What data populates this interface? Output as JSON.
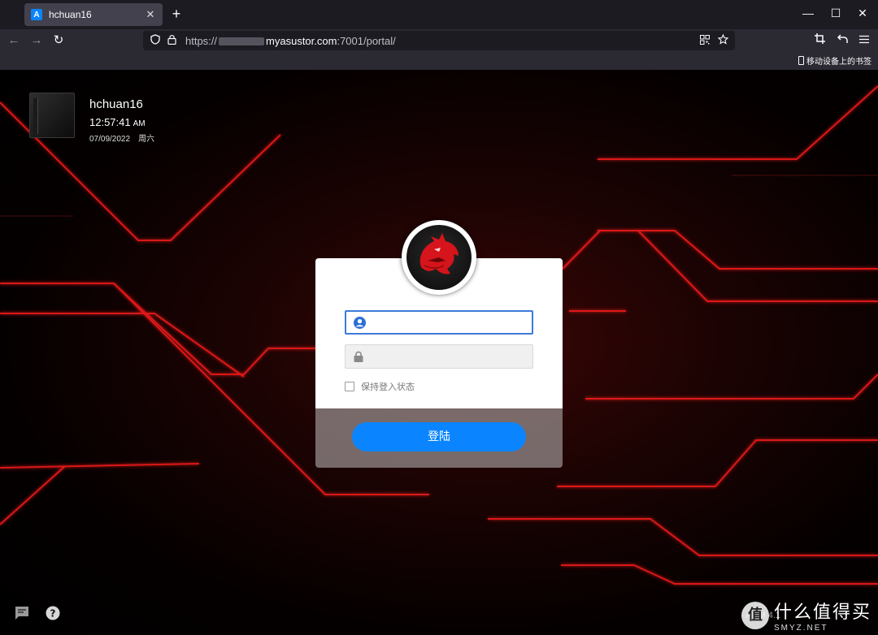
{
  "browser": {
    "tab_title": "hchuan16",
    "tab_favicon_letter": "A",
    "tab_close": "✕",
    "new_tab": "+",
    "url_prefix": "https://",
    "url_host": "myasustor.com",
    "url_path": ":7001/portal/",
    "bookmark_mobile": "移动设备上的书签",
    "window_controls": {
      "minimize": "—",
      "maximize": "☐",
      "close": "✕"
    },
    "nav": {
      "back": "←",
      "forward": "→",
      "reload": "↻"
    }
  },
  "device": {
    "name": "hchuan16",
    "time": "12:57:41",
    "ampm": "AM",
    "date": "07/09/2022",
    "weekday": "周六"
  },
  "login": {
    "username_value": "",
    "password_value": "",
    "remember_label": "保持登入状态",
    "remember_checked": false,
    "submit_label": "登陆"
  },
  "footer": {
    "version_text": "ADM 4.1"
  },
  "watermark": {
    "circle": "值",
    "cn": "什么值得买",
    "en": "SMYZ.NET"
  },
  "icons": {
    "user_field": "user-circle-icon",
    "password_field": "lock-icon",
    "footer_left": "message-icon",
    "footer_help": "help-icon",
    "logo": "dragon-logo-icon"
  },
  "colors": {
    "accent_blue": "#0a84ff",
    "field_focus": "#3d7bd9",
    "circuit_red": "#ff1a1a"
  }
}
